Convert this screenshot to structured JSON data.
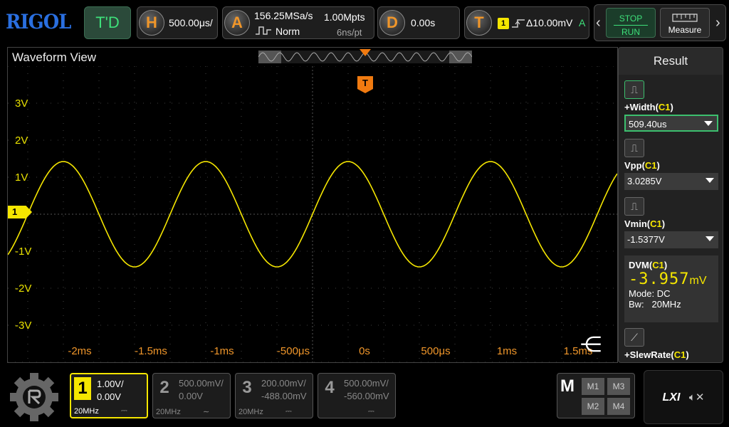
{
  "brand": "RIGOL",
  "top": {
    "td_label": "T'D",
    "horizontal": {
      "letter": "H",
      "timebase": "500.00μs/"
    },
    "acquire": {
      "letter": "A",
      "sample_rate": "156.25MSa/s",
      "memory_depth": "1.00Mpts",
      "mode": "Norm",
      "resolution": "6ns/pt"
    },
    "delay": {
      "letter": "D",
      "value": "0.00s"
    },
    "trigger": {
      "letter": "T",
      "source": "1",
      "level": "Δ10.00mV",
      "mode": "A"
    },
    "run_control": {
      "stop": "STOP",
      "run": "RUN"
    },
    "measure_label": "Measure",
    "prev_icon": "chevron-left-icon",
    "next_icon": "chevron-right-icon"
  },
  "waveform": {
    "title": "Waveform View",
    "y_labels": [
      "3V",
      "2V",
      "1V",
      "-1V",
      "-2V",
      "-3V"
    ],
    "x_labels": [
      "-2ms",
      "-1.5ms",
      "-1ms",
      "-500μs",
      "0s",
      "500μs",
      "1ms",
      "1.5ms"
    ],
    "channel_marker": "1",
    "trigger_marker": "T",
    "trace_color": "#f5e600",
    "axis_color": "#f0962a"
  },
  "result": {
    "title": "Result",
    "items": [
      {
        "name": "+Width",
        "source": "C1",
        "value": "509.40us"
      },
      {
        "name": "Vpp",
        "source": "C1",
        "value": "3.0285V"
      },
      {
        "name": "Vmin",
        "source": "C1",
        "value": "-1.5377V"
      }
    ],
    "dvm": {
      "name": "DVM",
      "source": "C1",
      "reading": "-3.957",
      "unit": "mV",
      "mode": "Mode: DC",
      "bw_label": "Bw:",
      "bw": "20MHz"
    },
    "next_item": {
      "name": "+SlewRate",
      "source": "C1"
    }
  },
  "channels": [
    {
      "num": "1",
      "scale": "1.00V/",
      "offset": "0.00V",
      "bw": "20MHz",
      "active": true
    },
    {
      "num": "2",
      "scale": "500.00mV/",
      "offset": "0.00V",
      "bw": "20MHz",
      "active": false
    },
    {
      "num": "3",
      "scale": "200.00mV/",
      "offset": "-488.00mV",
      "bw": "20MHz",
      "active": false
    },
    {
      "num": "4",
      "scale": "500.00mV/",
      "offset": "-560.00mV",
      "bw": "",
      "active": false
    }
  ],
  "math": {
    "label": "M",
    "buttons": [
      "M1",
      "M2",
      "M3",
      "M4"
    ]
  },
  "lxi": "LXI"
}
